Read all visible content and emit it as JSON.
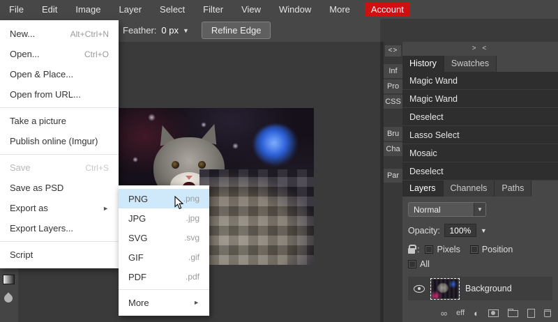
{
  "menubar": {
    "items": [
      "File",
      "Edit",
      "Image",
      "Layer",
      "Select",
      "Filter",
      "View",
      "Window",
      "More"
    ],
    "account": "Account"
  },
  "options_bar": {
    "feather_label": "Feather:",
    "feather_value": "0 px",
    "refine_edge": "Refine Edge"
  },
  "file_menu": {
    "items": [
      {
        "label": "New...",
        "shortcut": "Alt+Ctrl+N"
      },
      {
        "label": "Open...",
        "shortcut": "Ctrl+O"
      },
      {
        "label": "Open & Place...",
        "shortcut": ""
      },
      {
        "label": "Open from URL...",
        "shortcut": ""
      },
      {
        "label": "Take a picture",
        "shortcut": ""
      },
      {
        "label": "Publish online (Imgur)",
        "shortcut": ""
      },
      {
        "label": "Save",
        "shortcut": "Ctrl+S"
      },
      {
        "label": "Save as PSD",
        "shortcut": ""
      },
      {
        "label": "Export as",
        "shortcut": ""
      },
      {
        "label": "Export Layers...",
        "shortcut": ""
      },
      {
        "label": "Script",
        "shortcut": ""
      }
    ]
  },
  "export_menu": {
    "items": [
      {
        "label": "PNG",
        "ext": ".png"
      },
      {
        "label": "JPG",
        "ext": ".jpg"
      },
      {
        "label": "SVG",
        "ext": ".svg"
      },
      {
        "label": "GIF",
        "ext": ".gif"
      },
      {
        "label": "PDF",
        "ext": ".pdf"
      },
      {
        "label": "More",
        "ext": ""
      }
    ]
  },
  "collapsed_panels": {
    "toggle": "<>",
    "items": [
      "Inf",
      "Pro",
      "CSS",
      "Bru",
      "Cha",
      "Par"
    ]
  },
  "right_panel": {
    "collapse": "> <",
    "tabs_top": [
      "History",
      "Swatches"
    ],
    "history": [
      "Magic Wand",
      "Magic Wand",
      "Deselect",
      "Lasso Select",
      "Mosaic",
      "Deselect"
    ],
    "tabs_layers": [
      "Layers",
      "Channels",
      "Paths"
    ],
    "blend_mode": "Normal",
    "opacity_label": "Opacity:",
    "opacity_value": "100%",
    "lock_colon": ":",
    "lock_pixels": "Pixels",
    "lock_position": "Position",
    "lock_all": "All",
    "layer_name": "Background",
    "eff": "eff"
  },
  "icons": {
    "dropdown_arrow": "▼",
    "submenu_arrow": "►",
    "link": "∞",
    "adjustment": "◐"
  }
}
